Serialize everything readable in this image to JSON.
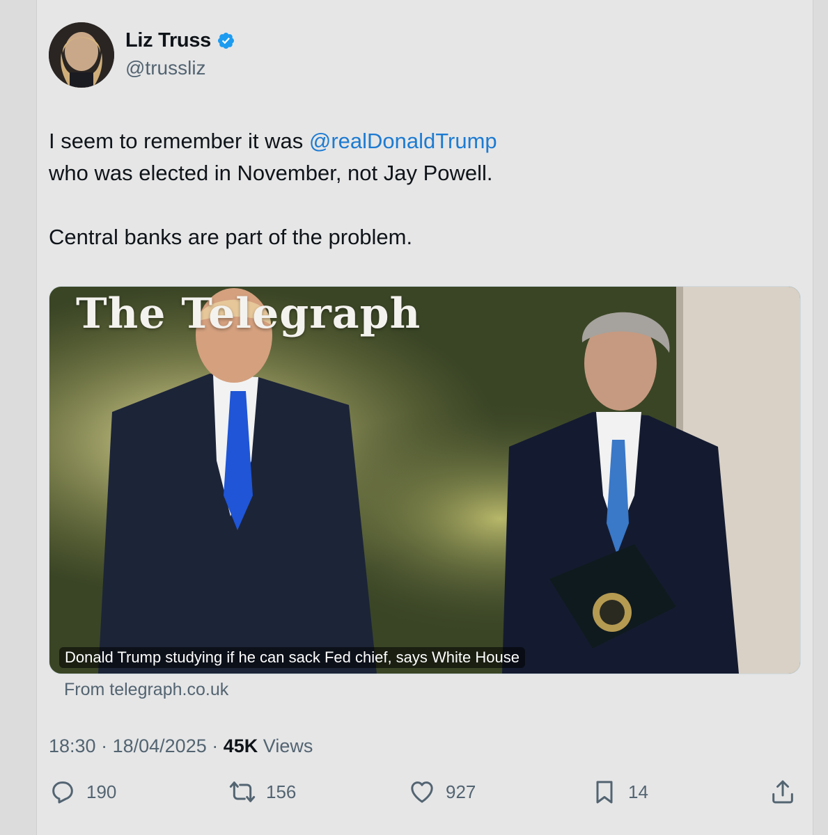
{
  "author": {
    "display_name": "Liz Truss",
    "handle": "@trussliz",
    "verified": true
  },
  "tweet": {
    "line1_prefix": "I seem to remember it was ",
    "mention": "@realDonaldTrump",
    "line2": "who was elected in November, not Jay Powell.",
    "line3": "Central banks are part of the problem."
  },
  "card": {
    "masthead": "The Telegraph",
    "caption": "Donald Trump studying if he can sack Fed chief, says White House",
    "source": "From telegraph.co.uk"
  },
  "meta": {
    "time": "18:30",
    "date": "18/04/2025",
    "views_count": "45K",
    "views_label": "Views"
  },
  "actions": {
    "replies": "190",
    "reposts": "156",
    "likes": "927",
    "bookmarks": "14"
  },
  "colors": {
    "accent": "#1d9bf0",
    "mention": "#1d7bd1",
    "secondary_text": "#536471"
  }
}
